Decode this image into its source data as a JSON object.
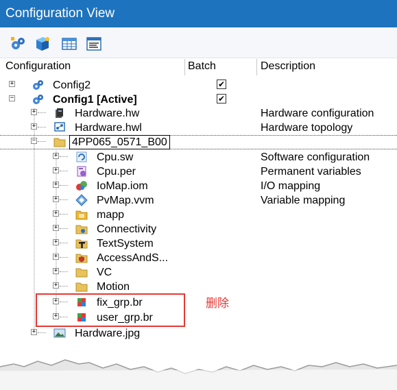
{
  "window": {
    "title": "Configuration View"
  },
  "toolbar": {
    "buttons": [
      "config-icon",
      "cube-icon",
      "grid-icon",
      "window-icon"
    ]
  },
  "columns": {
    "configuration": "Configuration",
    "batch": "Batch",
    "description": "Description"
  },
  "tree": {
    "config2": "Config2",
    "config1": "Config1 [Active]",
    "hardware_hw": "Hardware.hw",
    "hardware_hw_desc": "Hardware configuration",
    "hardware_hwl": "Hardware.hwl",
    "hardware_hwl_desc": "Hardware topology",
    "device": "4PP065_0571_B00",
    "cpu_sw": "Cpu.sw",
    "cpu_sw_desc": "Software configuration",
    "cpu_per": "Cpu.per",
    "cpu_per_desc": "Permanent variables",
    "iomap": "IoMap.iom",
    "iomap_desc": "I/O mapping",
    "pvmap": "PvMap.vvm",
    "pvmap_desc": "Variable mapping",
    "mapp": "mapp",
    "connectivity": "Connectivity",
    "textsystem": "TextSystem",
    "access": "AccessAndS...",
    "vc": "VC",
    "motion": "Motion",
    "fix_grp": "fix_grp.br",
    "user_grp": "user_grp.br",
    "hardware_jpg": "Hardware.jpg"
  },
  "annotation": {
    "delete_label": "删除"
  },
  "colors": {
    "titlebar": "#1E73BE",
    "annotation": "#E53935"
  }
}
